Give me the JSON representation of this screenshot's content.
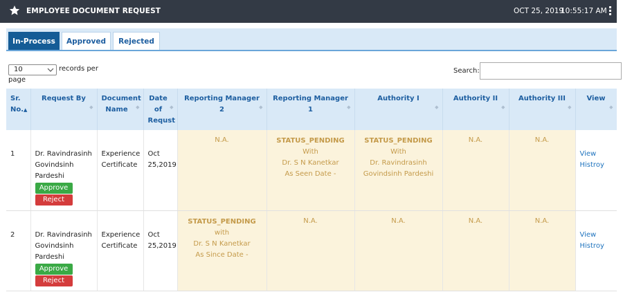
{
  "header": {
    "title": "EMPLOYEE DOCUMENT REQUEST",
    "date": "OCT 25, 2019",
    "time": "10:55:17 AM"
  },
  "tabs": [
    {
      "label": "In-Process",
      "active": true
    },
    {
      "label": "Approved",
      "active": false
    },
    {
      "label": "Rejected",
      "active": false
    }
  ],
  "length_menu": {
    "value": "10",
    "label": "records per",
    "label_tail": "page"
  },
  "search": {
    "label": "Search:",
    "value": ""
  },
  "table": {
    "columns": [
      "Sr. No.",
      "Request By",
      "Document Name",
      "Date of Requst",
      "Reporting Manager 2",
      "Reporting Manager 1",
      "Authority I",
      "Authority II",
      "Authority III",
      "View"
    ],
    "rows": [
      {
        "sr": "1",
        "request_by": [
          "Dr. Ravindrasinh",
          "Govindsinh",
          "Pardeshi"
        ],
        "doc": [
          "Experience",
          "Certificate"
        ],
        "date": [
          "Oct",
          "25,2019"
        ],
        "rm2": {
          "status": "",
          "lines": [
            "N.A."
          ]
        },
        "rm1": {
          "status": "STATUS_PENDING",
          "lines": [
            "With",
            "Dr. S N Kanetkar",
            "As Seen Date  -"
          ]
        },
        "auth1": {
          "status": "STATUS_PENDING",
          "lines": [
            "With",
            "Dr. Ravindrasinh",
            "Govindsinh Pardeshi"
          ]
        },
        "auth2": {
          "status": "",
          "lines": [
            "N.A."
          ]
        },
        "auth3": {
          "status": "",
          "lines": [
            "N.A."
          ]
        },
        "view": [
          "View",
          "Histroy"
        ],
        "approve": "Approve",
        "reject": "Reject"
      },
      {
        "sr": "2",
        "request_by": [
          "Dr. Ravindrasinh",
          "Govindsinh",
          "Pardeshi"
        ],
        "doc": [
          "Experience",
          "Certificate"
        ],
        "date": [
          "Oct",
          "25,2019"
        ],
        "rm2": {
          "status": "STATUS_PENDING",
          "lines": [
            "with",
            "Dr. S N Kanetkar",
            "As Since Date  -"
          ]
        },
        "rm1": {
          "status": "",
          "lines": [
            "N.A."
          ]
        },
        "auth1": {
          "status": "",
          "lines": [
            "N.A."
          ]
        },
        "auth2": {
          "status": "",
          "lines": [
            "N.A."
          ]
        },
        "auth3": {
          "status": "",
          "lines": [
            "N.A."
          ]
        },
        "view": [
          "View",
          "Histroy"
        ],
        "approve": "Approve",
        "reject": "Reject"
      }
    ]
  }
}
